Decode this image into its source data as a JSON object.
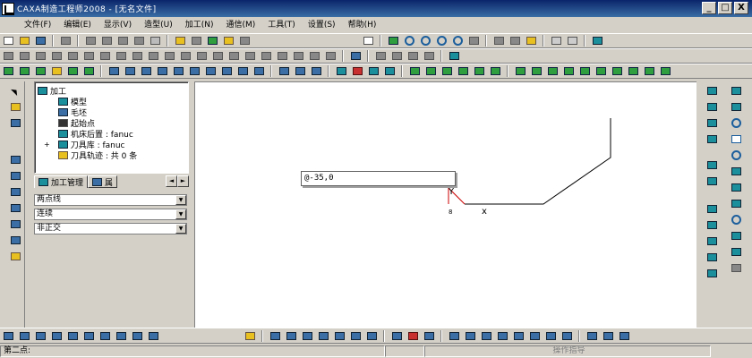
{
  "window": {
    "title": "CAXA制造工程师2008   - [无名文件]",
    "buttons": [
      "_",
      "□",
      "X"
    ]
  },
  "menu": [
    {
      "label": "文件(F)"
    },
    {
      "label": "编辑(E)"
    },
    {
      "label": "显示(V)"
    },
    {
      "label": "造型(U)"
    },
    {
      "label": "加工(N)"
    },
    {
      "label": "通信(M)"
    },
    {
      "label": "工具(T)"
    },
    {
      "label": "设置(S)"
    },
    {
      "label": "帮助(H)"
    }
  ],
  "tree": {
    "root": "加工",
    "items": [
      {
        "label": "模型"
      },
      {
        "label": "毛坯"
      },
      {
        "label": "起始点"
      },
      {
        "label": "机床后置 : fanuc"
      },
      {
        "label": "刀具库 : fanuc"
      },
      {
        "label": "刀具轨迹 : 共 0 条"
      }
    ]
  },
  "tabs": [
    {
      "label": "加工管理"
    },
    {
      "label": "属"
    }
  ],
  "tab_arrows": [
    "◄",
    "►"
  ],
  "combos": [
    {
      "value": "两点线"
    },
    {
      "value": "连续"
    },
    {
      "value": "非正交"
    }
  ],
  "canvas": {
    "input_value": "@-35,0",
    "point_marker": "x",
    "small_label": "8"
  },
  "status": {
    "prompt": "第二点:",
    "center": "",
    "hint": "操作指导"
  }
}
